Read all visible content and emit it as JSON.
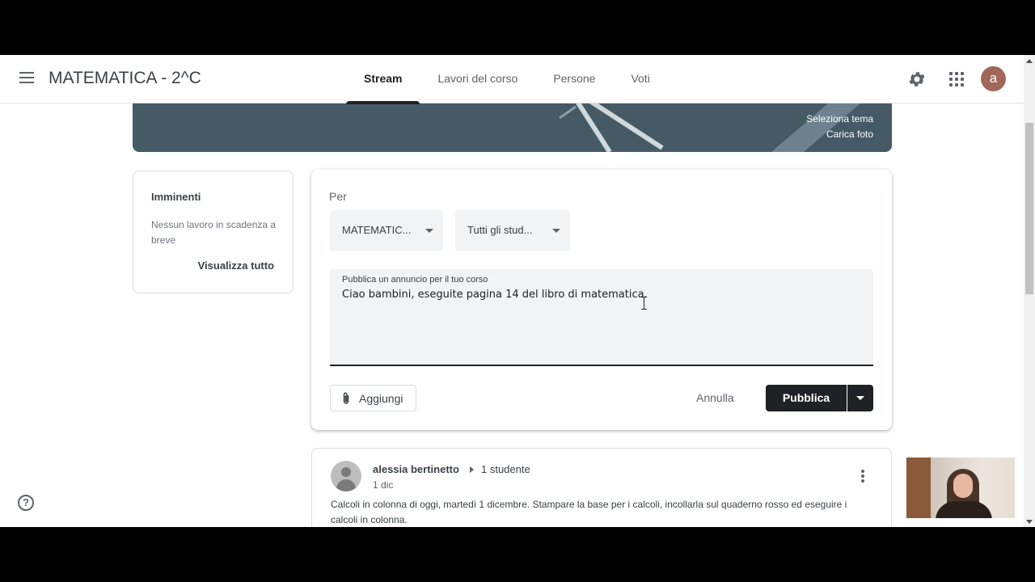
{
  "header": {
    "class_title": "MATEMATICA - 2^C",
    "tabs": [
      {
        "label": "Stream",
        "active": true
      },
      {
        "label": "Lavori del corso",
        "active": false
      },
      {
        "label": "Persone",
        "active": false
      },
      {
        "label": "Voti",
        "active": false
      }
    ],
    "avatar_letter": "a"
  },
  "banner": {
    "select_theme": "Seleziona tema",
    "upload_photo": "Carica foto"
  },
  "upcoming": {
    "title": "Imminenti",
    "empty_text": "Nessun lavoro in scadenza a breve",
    "view_all": "Visualizza tutto"
  },
  "compose": {
    "for_label": "Per",
    "course_dropdown": "MATEMATIC...",
    "students_dropdown": "Tutti gli stud...",
    "field_label": "Pubblica un annuncio per il tuo corso",
    "field_value": "Ciao bambini, eseguite pagina 14 del libro di matematica.",
    "add_label": "Aggiungi",
    "cancel_label": "Annulla",
    "publish_label": "Pubblica"
  },
  "post": {
    "author": "alessia bertinetto",
    "audience": "1 studente",
    "date": "1 dic",
    "text": "Calcoli in colonna di oggi, martedì 1 dicembre. Stampare la base per i calcoli, incollarla sul quaderno rosso ed eseguire i calcoli in colonna."
  },
  "icons": {
    "menu": "menu-icon",
    "settings": "gear-icon",
    "apps": "apps-grid-icon",
    "attach": "paperclip-icon",
    "more": "more-vert-icon",
    "help": "help-icon"
  },
  "colors": {
    "banner": "#455a64",
    "publish_button": "#202124",
    "avatar": "#a1675a"
  }
}
